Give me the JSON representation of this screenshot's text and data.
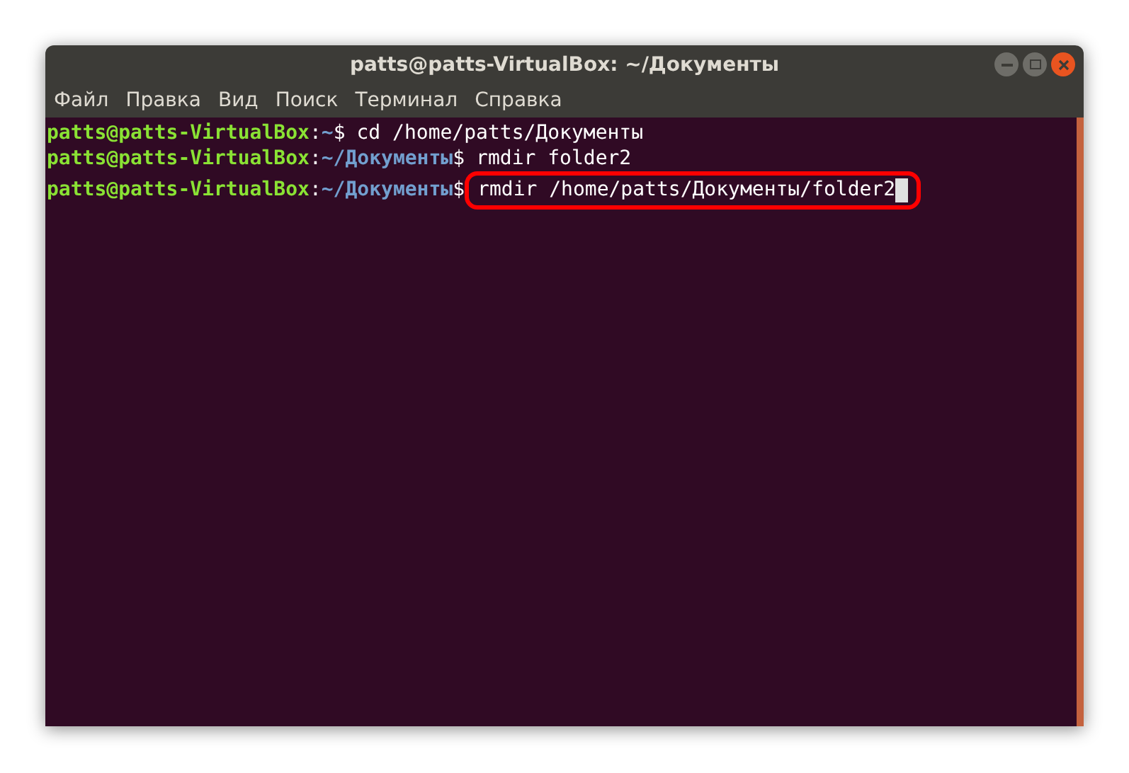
{
  "window": {
    "title": "patts@patts-VirtualBox: ~/Документы"
  },
  "menu": [
    "Файл",
    "Правка",
    "Вид",
    "Поиск",
    "Терминал",
    "Справка"
  ],
  "terminal": {
    "lines": [
      {
        "user_host": "patts@patts-VirtualBox",
        "separator": ":",
        "path": "~",
        "prompt": "$",
        "command": "cd /home/patts/Документы",
        "highlighted": false,
        "cursor": false
      },
      {
        "user_host": "patts@patts-VirtualBox",
        "separator": ":",
        "path": "~/Документы",
        "prompt": "$",
        "command": "rmdir folder2",
        "highlighted": false,
        "cursor": false
      },
      {
        "user_host": "patts@patts-VirtualBox",
        "separator": ":",
        "path": "~/Документы",
        "prompt": "$",
        "command": "rmdir /home/patts/Документы/folder2",
        "highlighted": true,
        "cursor": true
      }
    ]
  }
}
